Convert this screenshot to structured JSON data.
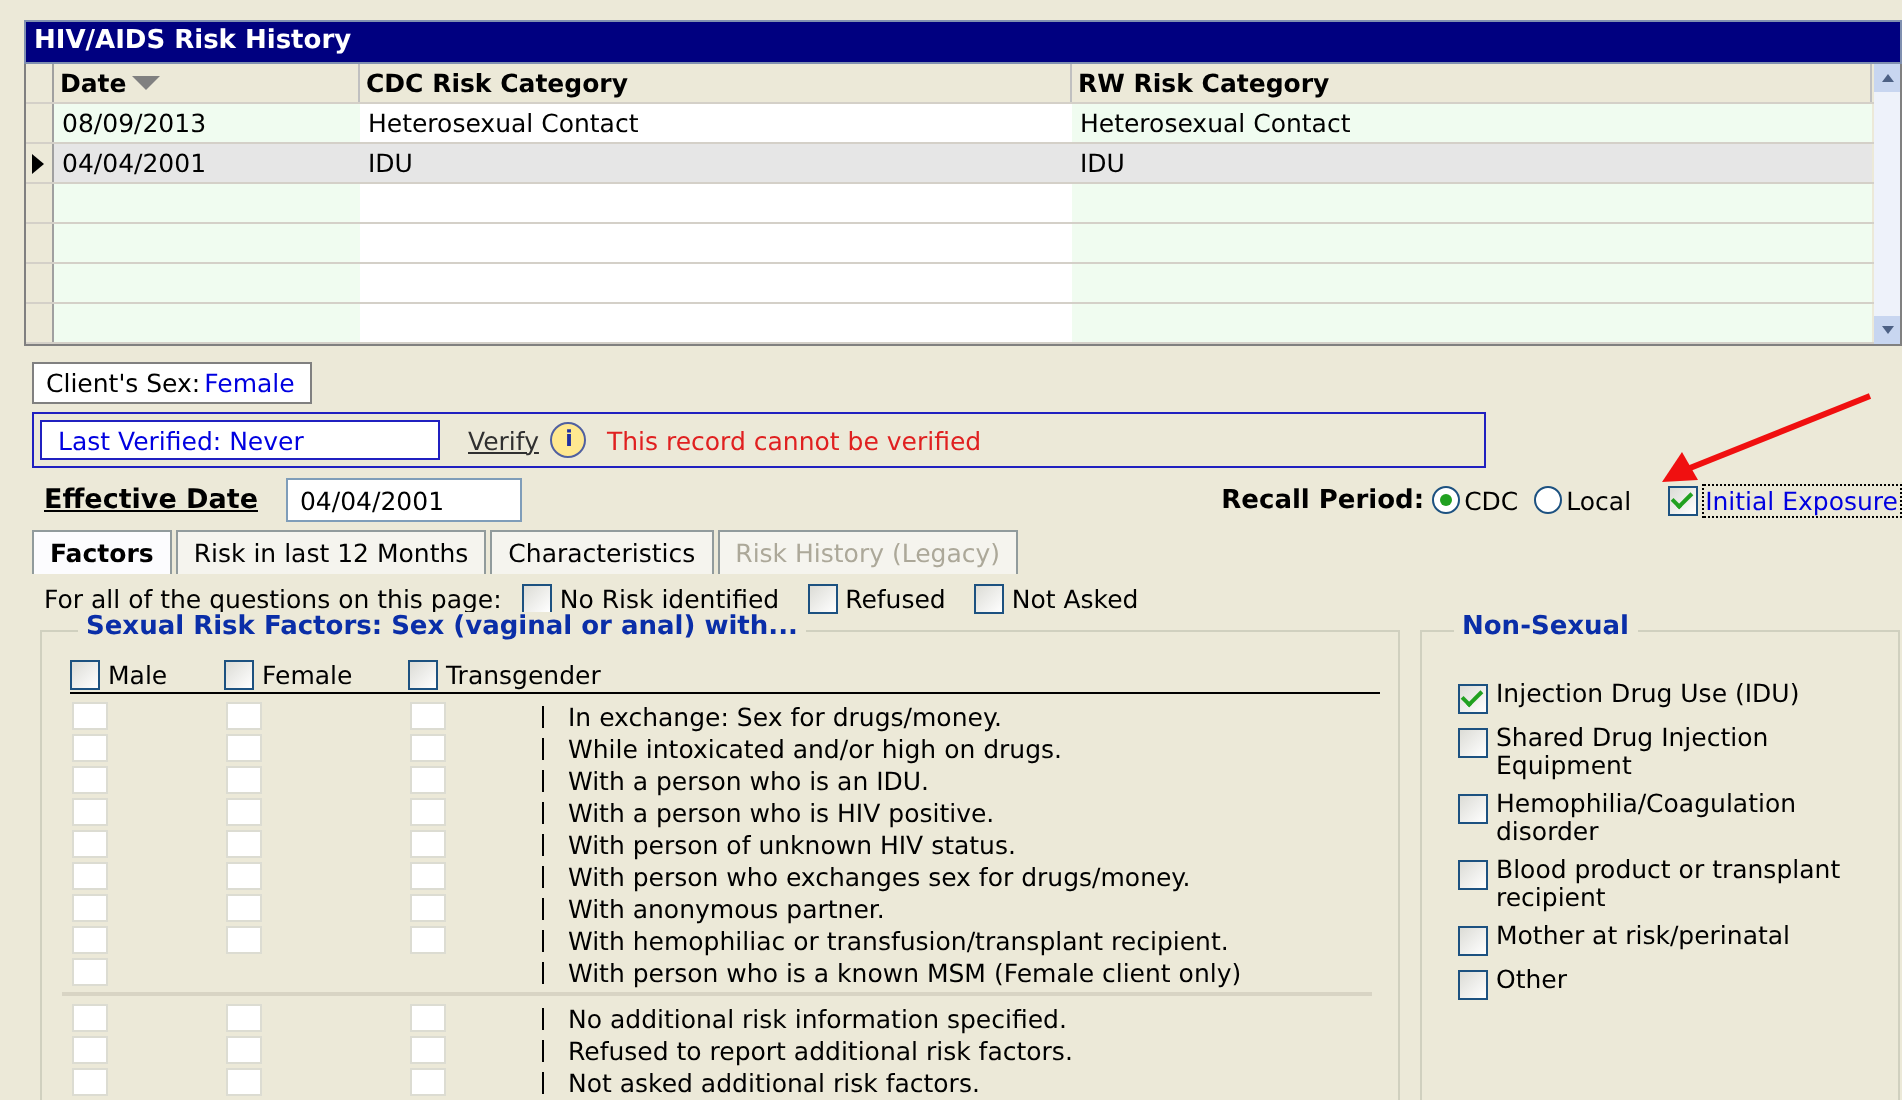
{
  "window": {
    "title": "HIV/AIDS Risk History"
  },
  "table": {
    "columns": [
      {
        "label": "Date",
        "sorted": true
      },
      {
        "label": "CDC Risk Category",
        "sorted": false
      },
      {
        "label": "RW Risk Category",
        "sorted": false
      }
    ],
    "rows": [
      {
        "cells": [
          "08/09/2013",
          "Heterosexual Contact",
          "Heterosexual Contact"
        ],
        "selected": false
      },
      {
        "cells": [
          "04/04/2001",
          "IDU",
          "IDU"
        ],
        "selected": true
      }
    ]
  },
  "client_sex": {
    "label": "Client's Sex:",
    "value": "Female"
  },
  "verification": {
    "last_verified": "Last Verified: Never",
    "verify_link": "Verify",
    "info_icon": "i",
    "message": "This record cannot be verified"
  },
  "effective_date": {
    "label": "Effective Date",
    "value": "04/04/2001"
  },
  "recall_period": {
    "label": "Recall Period:",
    "options": [
      {
        "label": "CDC",
        "selected": true
      },
      {
        "label": "Local",
        "selected": false
      }
    ]
  },
  "initial_exposure": {
    "label": "Initial Exposure",
    "checked": true
  },
  "tabs": [
    {
      "label": "Factors",
      "selected": true,
      "disabled": false
    },
    {
      "label": "Risk in last 12 Months",
      "selected": false,
      "disabled": false
    },
    {
      "label": "Characteristics",
      "selected": false,
      "disabled": false
    },
    {
      "label": "Risk History (Legacy)",
      "selected": false,
      "disabled": true
    }
  ],
  "page_options": {
    "label": "For all of the questions on this page:",
    "options": [
      {
        "label": "No Risk identified",
        "checked": false
      },
      {
        "label": "Refused",
        "checked": false
      },
      {
        "label": "Not Asked",
        "checked": false
      }
    ]
  },
  "sexual": {
    "title": "Sexual Risk Factors: Sex (vaginal or anal) with...",
    "genders": [
      {
        "label": "Male",
        "checked": false
      },
      {
        "label": "Female",
        "checked": false
      },
      {
        "label": "Transgender",
        "checked": false
      }
    ],
    "groups": [
      [
        {
          "text": "In exchange: Sex for drugs/money.",
          "boxes": [
            false,
            false,
            false
          ]
        },
        {
          "text": "While intoxicated and/or high on drugs.",
          "boxes": [
            false,
            false,
            false
          ]
        },
        {
          "text": "With a person who is an IDU.",
          "boxes": [
            false,
            false,
            false
          ]
        },
        {
          "text": "With a person who is HIV positive.",
          "boxes": [
            false,
            false,
            false
          ]
        },
        {
          "text": "With person of unknown HIV status.",
          "boxes": [
            false,
            false,
            false
          ]
        },
        {
          "text": "With person who exchanges sex for drugs/money.",
          "boxes": [
            false,
            false,
            false
          ]
        },
        {
          "text": "With anonymous partner.",
          "boxes": [
            false,
            false,
            false
          ]
        },
        {
          "text": "With hemophiliac or transfusion/transplant recipient.",
          "boxes": [
            false,
            false,
            false
          ]
        },
        {
          "text": "With person who is a known MSM (Female client only)",
          "boxes": [
            false
          ]
        }
      ],
      [
        {
          "text": "No additional risk information specified.",
          "boxes": [
            false,
            false,
            false
          ]
        },
        {
          "text": "Refused to report additional risk factors.",
          "boxes": [
            false,
            false,
            false
          ]
        },
        {
          "text": "Not asked additional risk factors.",
          "boxes": [
            false,
            false,
            false
          ]
        }
      ]
    ]
  },
  "non_sexual": {
    "title": "Non-Sexual",
    "items": [
      {
        "label": "Injection Drug Use (IDU)",
        "checked": true
      },
      {
        "label": "Shared Drug Injection Equipment",
        "checked": false
      },
      {
        "label": "Hemophilia/Coagulation disorder",
        "checked": false
      },
      {
        "label": "Blood product or transplant recipient",
        "checked": false
      },
      {
        "label": "Mother at risk/perinatal",
        "checked": false
      },
      {
        "label": "Other",
        "checked": false
      }
    ]
  }
}
